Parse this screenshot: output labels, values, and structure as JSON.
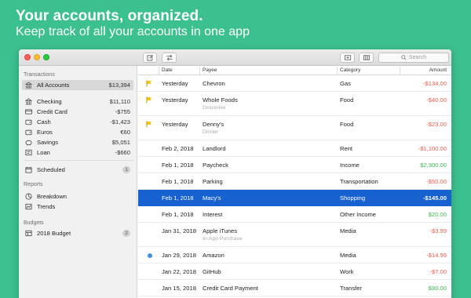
{
  "hero": {
    "title": "Your accounts, organized.",
    "subtitle": "Keep track of all your accounts in one app"
  },
  "toolbar": {
    "search_placeholder": "Search",
    "icons": [
      "compose-icon",
      "transfer-icon",
      "add-account-icon",
      "columns-icon"
    ]
  },
  "sidebar": {
    "transactions_header": "Transactions",
    "all_accounts": {
      "label": "All Accounts",
      "value": "$13,394"
    },
    "accounts": [
      {
        "label": "Checking",
        "value": "$11,110",
        "icon": "bank-icon"
      },
      {
        "label": "Credit Card",
        "value": "-$755",
        "icon": "card-icon"
      },
      {
        "label": "Cash",
        "value": "-$1,423",
        "icon": "wallet-icon"
      },
      {
        "label": "Euros",
        "value": "€60",
        "icon": "wallet-icon"
      },
      {
        "label": "Savings",
        "value": "$5,051",
        "icon": "piggy-icon"
      },
      {
        "label": "Loan",
        "value": "-$660",
        "icon": "loan-icon"
      }
    ],
    "scheduled": {
      "label": "Scheduled",
      "badge": "1"
    },
    "reports_header": "Reports",
    "reports": [
      {
        "label": "Breakdown",
        "icon": "pie-icon"
      },
      {
        "label": "Trends",
        "icon": "trends-icon"
      }
    ],
    "budgets_header": "Budgets",
    "budgets": [
      {
        "label": "2018 Budget",
        "badge": "2"
      }
    ]
  },
  "table": {
    "headers": {
      "date": "Date",
      "payee": "Payee",
      "category": "Category",
      "amount": "Amount"
    },
    "rows": [
      {
        "date": "Yesterday",
        "payee": "Chevron",
        "memo": "",
        "category": "Gas",
        "amount": "-$134.00",
        "sign": "neg",
        "marker": "flag"
      },
      {
        "date": "Yesterday",
        "payee": "Whole Foods",
        "memo": "Groceries",
        "category": "Food",
        "amount": "-$40.00",
        "sign": "neg",
        "marker": "flag"
      },
      {
        "date": "Yesterday",
        "payee": "Denny's",
        "memo": "Dinner",
        "category": "Food",
        "amount": "-$23.00",
        "sign": "neg",
        "marker": "flag"
      },
      {
        "date": "Feb 2, 2018",
        "payee": "Landlord",
        "memo": "",
        "category": "Rent",
        "amount": "-$1,100.00",
        "sign": "neg",
        "marker": ""
      },
      {
        "date": "Feb 1, 2018",
        "payee": "Paycheck",
        "memo": "",
        "category": "Income",
        "amount": "$2,300.00",
        "sign": "pos",
        "marker": ""
      },
      {
        "date": "Feb 1, 2018",
        "payee": "Parking",
        "memo": "",
        "category": "Transportation",
        "amount": "-$50.00",
        "sign": "neg",
        "marker": ""
      },
      {
        "date": "Feb 1, 2018",
        "payee": "Macy's",
        "memo": "",
        "category": "Shopping",
        "amount": "-$145.00",
        "sign": "neg",
        "marker": "",
        "selected": true
      },
      {
        "date": "Feb 1, 2018",
        "payee": "Interest",
        "memo": "",
        "category": "Other Income",
        "amount": "$20.00",
        "sign": "pos",
        "marker": ""
      },
      {
        "date": "Jan 31, 2018",
        "payee": "Apple iTunes",
        "memo": "In-App Purchase",
        "category": "Media",
        "amount": "-$3.99",
        "sign": "neg",
        "marker": ""
      },
      {
        "date": "Jan 29, 2018",
        "payee": "Amazon",
        "memo": "",
        "category": "Media",
        "amount": "-$14.99",
        "sign": "neg",
        "marker": "dot"
      },
      {
        "date": "Jan 22, 2018",
        "payee": "GitHub",
        "memo": "",
        "category": "Work",
        "amount": "-$7.00",
        "sign": "neg",
        "marker": ""
      },
      {
        "date": "Jan 15, 2018",
        "payee": "Credit Card Payment",
        "memo": "",
        "category": "Transfer",
        "amount": "$90.00",
        "sign": "pos",
        "marker": ""
      }
    ]
  },
  "colors": {
    "background": "#3cc08e",
    "selection": "#1762d0",
    "negative": "#f05a4b",
    "positive": "#3cb94e",
    "flag": "#f5c518",
    "unread_dot": "#3f92e2"
  }
}
